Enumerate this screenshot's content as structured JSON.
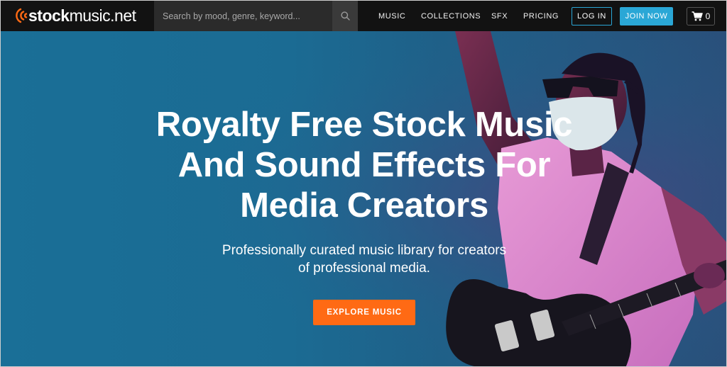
{
  "brand": {
    "logo_bold": "stock",
    "logo_rest": "music.net",
    "logo_icon": "sound-waves-icon",
    "logo_color": "#ff6a14"
  },
  "search": {
    "placeholder": "Search by mood, genre, keyword...",
    "value": "",
    "icon": "search-icon"
  },
  "nav": {
    "items": [
      {
        "label": "MUSIC"
      },
      {
        "label": "COLLECTIONS"
      },
      {
        "label": "SFX"
      },
      {
        "label": "PRICING"
      }
    ],
    "login_label": "LOG IN",
    "join_label": "JOIN NOW",
    "cart_icon": "cart-icon",
    "cart_count": "0",
    "accent_color": "#2aa7d6"
  },
  "hero": {
    "headline_lines": [
      "Royalty Free Stock Music",
      "And Sound Effects For",
      "Media Creators"
    ],
    "subtitle_lines": [
      "Professionally curated music library for creators",
      "of professional media."
    ],
    "cta_label": "EXPLORE MUSIC",
    "cta_color": "#ff6a14"
  }
}
